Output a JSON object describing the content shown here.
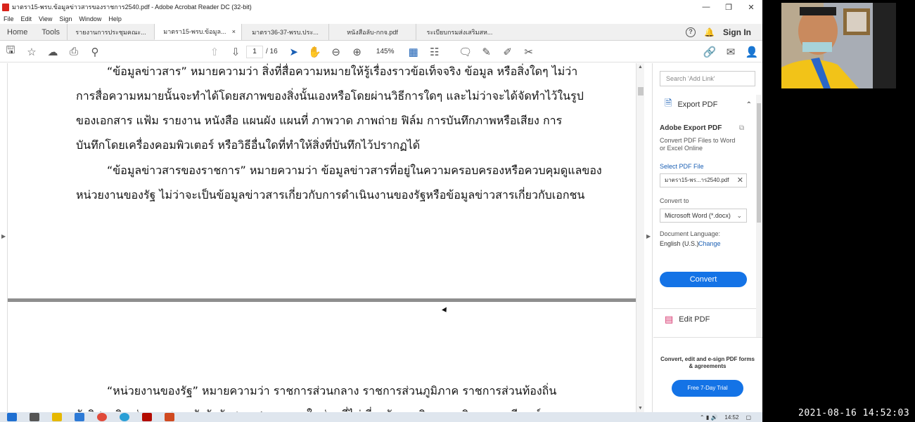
{
  "window": {
    "title": "มาตรา15-พรบ.ข้อมูลข่าวสารของราชการ2540.pdf - Adobe Acrobat Reader DC (32-bit)",
    "minimize": "—",
    "maximize": "❐",
    "close": "✕"
  },
  "menu": [
    "File",
    "Edit",
    "View",
    "Sign",
    "Window",
    "Help"
  ],
  "tabs": {
    "home": "Home",
    "tools": "Tools",
    "docs": [
      {
        "label": "รายงานการประชุมคณะ...",
        "active": false
      },
      {
        "label": "มาตรา15-พรบ.ข้อมูล...",
        "active": true,
        "close": "×"
      },
      {
        "label": "มาตรา36-37-พรบ.ประ...",
        "active": false
      },
      {
        "label": "หนังสือลับ-กกจ.pdf",
        "active": false
      },
      {
        "label": "ระเบียบกรมส่งเสริมสห...",
        "active": false
      }
    ],
    "help_icon": "?",
    "signin": "Sign In"
  },
  "toolbar": {
    "page_current": "1",
    "page_total": "/ 16",
    "zoom": "145%"
  },
  "document": {
    "page1_lines": [
      "“ข้อมูลข่าวสาร” หมายความว่า  สิ่งที่สื่อความหมายให้รู้เรื่องราวข้อเท็จจริง ข้อมูล  หรือสิ่งใดๆ  ไม่ว่า",
      "การสื่อความหมายนั้นจะทำได้โดยสภาพของสิ่งนั้นเองหรือโดยผ่านวิธีการใดๆ  และไม่ว่าจะได้จัดทำไว้ในรูป",
      "ของเอกสาร แฟ้ม รายงาน หนังสือ แผนผัง แผนที่ ภาพวาด ภาพถ่าย ฟิล์ม การบันทึกภาพหรือเสียง การ",
      "บันทึกโดยเครื่องคอมพิวเตอร์ หรือวิธีอื่นใดที่ทำให้สิ่งที่บันทึกไว้ปรากฏได้",
      "“ข้อมูลข่าวสารของราชการ” หมายความว่า ข้อมูลข่าวสารที่อยู่ในความครอบครองหรือควบคุมดูแลของ",
      "หน่วยงานของรัฐ    ไม่ว่าจะเป็นข้อมูลข่าวสารเกี่ยวกับการดำเนินงานของรัฐหรือข้อมูลข่าวสารเกี่ยวกับเอกชน"
    ],
    "page2_lines": [
      "“หน่วยงานของรัฐ” หมายความว่า  ราชการส่วนกลาง  ราชการส่วนภูมิภาค ราชการส่วนท้องถิ่น",
      "รัฐวิสาหกิจ  ส่วนราชการสังกัดรัฐสภา  ศาลเฉพาะในส่วนที่ไม่เกี่ยวกับการพิจารณาพิพากษาคดี องค์กร"
    ]
  },
  "right_pane": {
    "search_placeholder": "Search 'Add Link'",
    "export_header": "Export PDF",
    "title": "Adobe Export PDF",
    "description": "Convert PDF Files to Word or Excel Online",
    "select_pdf": "Select PDF File",
    "file_name": "มาตรา15-พร...าร2540.pdf",
    "convert_to_label": "Convert to",
    "convert_to_value": "Microsoft Word (*.docx)",
    "doc_language_label": "Document Language:",
    "doc_language_value": "English (U.S.)",
    "change_link": "Change",
    "convert_button": "Convert",
    "edit_pdf": "Edit PDF",
    "promo": "Convert, edit and e-sign PDF forms & agreements",
    "trial_button": "Free 7-Day Trial"
  },
  "taskbar": {
    "clock": "14:52"
  },
  "overlay": {
    "timestamp": "2021-08-16 14:52:03"
  },
  "colors": {
    "acrobat_red": "#d8241c",
    "link_blue": "#1473e6",
    "separator_gray": "#8e8e8e"
  }
}
